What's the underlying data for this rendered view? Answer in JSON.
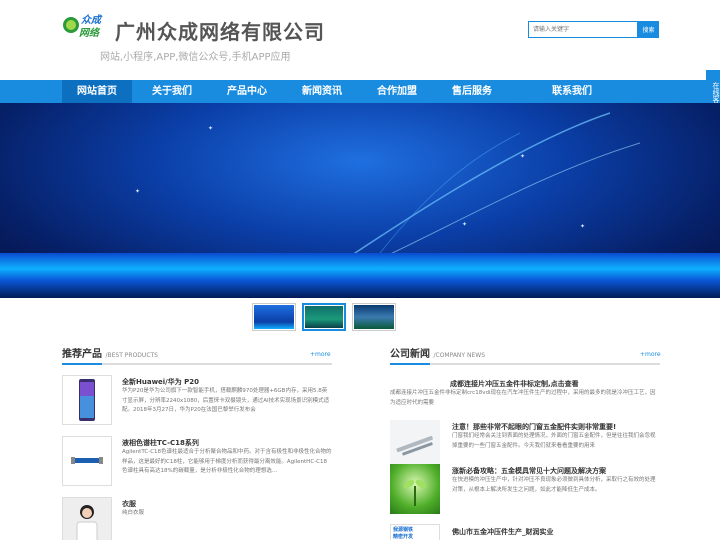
{
  "header": {
    "logo_line1": "众成",
    "logo_line2": "网络",
    "company_name": "广州众成网络有限公司",
    "slogan": "网站,小程序,APP,微信公众号,手机APP应用",
    "search_placeholder": "请输入关键字",
    "search_button": "搜索"
  },
  "nav": {
    "items": [
      "网站首页",
      "关于我们",
      "产品中心",
      "新闻资讯",
      "合作加盟",
      "售后服务",
      "联系我们"
    ]
  },
  "side_float": {
    "label": "在线客服"
  },
  "side_float_arrow": "«",
  "products": {
    "title": "推荐产品",
    "title_en": "/BEST PRODUCTS",
    "more": "+more",
    "items": [
      {
        "name": "全新Huawei/华为 P20",
        "desc": "华为P20是华为公司旗下一款智能手机，搭载麒麟970处理器+6GB内存，采用5.8英寸显示屏，分辨率2240x1080，后置徕卡双摄镜头，通过AI技术实现场景识别模式适配。2018年3月27日，华为P20在法国巴黎举行发布会"
      },
      {
        "name": "液相色谱柱TC-C18系列",
        "desc": "AgilentTC-C18色谱柱最适合于分析聚合物品和中药。对于含有极性和非极性化合物的样品，这是最好的C18柱，它能够用于梯度分析而获得最分离效能。AgilentHC-C18色谱柱具有高达18%的碳载量，是分析非极性化合物的理想选..."
      },
      {
        "name": "衣服",
        "desc": "纯白衣服"
      }
    ]
  },
  "news": {
    "title": "公司新闻",
    "title_en": "/COMPANY NEWS",
    "more": "+more",
    "items": [
      {
        "title": "成都连接片冲压五金件非标定制,点击查看",
        "desc": "成都连接片冲压五金件非标定制crc18vdi现在在汽车冲压件生产的过程中，采用的最多的就是冷冲压工艺，因为适应时代的需要"
      },
      {
        "title": "注意！那些非常不起眼的门窗五金配件实则非常重要!",
        "desc": "门窗我们经常会关注到表面的处理情况，外面的门窗五金配件，但是往往我们会忽视掉重要的一些门窗五金配件。今天我们就来看看重要的用来"
      },
      {
        "title": "涨新必备攻略：五金模具常见十大问题及解决方案",
        "desc": "在快进模的冲压生产中，针对冲压不良现象必须做到具体分析，采取行之有效的处理对策，从根本上解决所发生之问题，如此才能降低生产成本。"
      },
      {
        "title": "佛山市五金冲压件生产_财润实业",
        "desc": ""
      }
    ],
    "ad_line1": "我源钢铁",
    "ad_line2": "精密开发"
  },
  "colors": {
    "primary": "#1a8ce0",
    "nav_active": "#0d6fc0"
  }
}
